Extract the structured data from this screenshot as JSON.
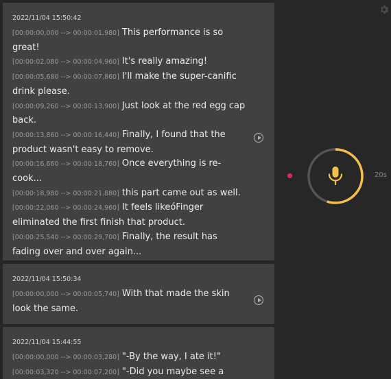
{
  "transcripts": [
    {
      "date": "2022/11/04 15:50:42",
      "lines": [
        {
          "ts": "[00:00:00,000 --> 00:00:01,980]",
          "text": "This performance is so great!"
        },
        {
          "ts": "[00:00:02,080 --> 00:00:04,960]",
          "text": "It's really amazing!"
        },
        {
          "ts": "[00:00:05,680 --> 00:00:07,860]",
          "text": "I'll make the super-canific drink please."
        },
        {
          "ts": "[00:00:09,260 --> 00:00:13,900]",
          "text": "Just look at the red egg cap back."
        },
        {
          "ts": "[00:00:13,860 --> 00:00:16,440]",
          "text": "Finally, I found that the product wasn't easy to remove."
        },
        {
          "ts": "[00:00:16,660 --> 00:00:18,760]",
          "text": "Once everything is re-cook..."
        },
        {
          "ts": "[00:00:18,980 --> 00:00:21,880]",
          "text": "this part came out as well."
        },
        {
          "ts": "[00:00:22,060 --> 00:00:24,960]",
          "text": "It feels likeóFinger eliminated the first finish that product."
        },
        {
          "ts": "[00:00:25,540 --> 00:00:29,700]",
          "text": "Finally, the result has fading over and over again..."
        }
      ]
    },
    {
      "date": "2022/11/04 15:50:34",
      "lines": [
        {
          "ts": "[00:00:00,000 --> 00:00:05,740]",
          "text": "With that made the skin look the same."
        }
      ]
    },
    {
      "date": "2022/11/04 15:44:55",
      "lines": [
        {
          "ts": "[00:00:00,000 --> 00:00:03,280]",
          "text": "\"-By the way, I ate it!\""
        },
        {
          "ts": "[00:00:03,320 --> 00:00:07,200]",
          "text": "\"-Did you maybe see a"
        }
      ]
    }
  ],
  "recorder": {
    "duration_label": "20s",
    "progress": 0.55,
    "colors": {
      "accent": "#f5c04a",
      "track": "#555555",
      "record_dot": "#e02a5b"
    },
    "icons": {
      "mic": "microphone-icon",
      "settings": "gear-icon",
      "play": "play-icon"
    }
  }
}
